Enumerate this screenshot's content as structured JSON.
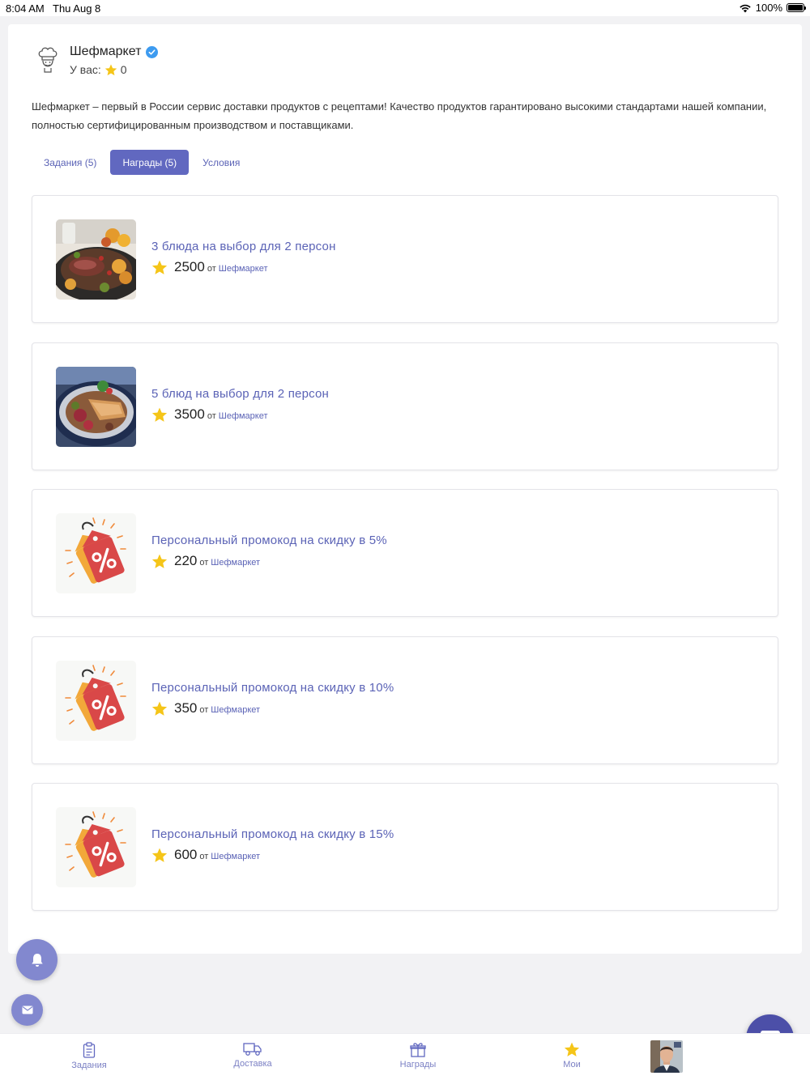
{
  "status": {
    "time": "8:04 AM",
    "date": "Thu Aug 8",
    "battery": "100%"
  },
  "brand": {
    "name": "Шефмаркет",
    "balance_label": "У вас:",
    "balance_value": "0"
  },
  "description": "Шефмаркет – первый в России сервис доставки продуктов с рецептами! Качество продуктов гарантировано высокими стандартами нашей компании, полностью сертифицированным производством и поставщиками.",
  "tabs": [
    {
      "label": "Задания (5)",
      "active": false
    },
    {
      "label": "Награды (5)",
      "active": true
    },
    {
      "label": "Условия",
      "active": false
    }
  ],
  "rewards": [
    {
      "title": "3 блюда на выбор для 2 персон",
      "price": "2500",
      "from": "от",
      "merchant": "Шефмаркет",
      "image": "food-steak"
    },
    {
      "title": "5 блюд на выбор для 2 персон",
      "price": "3500",
      "from": "от",
      "merchant": "Шефмаркет",
      "image": "food-chicken"
    },
    {
      "title": "Персональный промокод на скидку в 5%",
      "price": "220",
      "from": "от",
      "merchant": "Шефмаркет",
      "image": "discount-tag"
    },
    {
      "title": "Персональный промокод на скидку в 10%",
      "price": "350",
      "from": "от",
      "merchant": "Шефмаркет",
      "image": "discount-tag"
    },
    {
      "title": "Персональный промокод на скидку в 15%",
      "price": "600",
      "from": "от",
      "merchant": "Шефмаркет",
      "image": "discount-tag"
    }
  ],
  "nav": [
    {
      "label": "Задания",
      "icon": "clipboard-icon"
    },
    {
      "label": "Доставка",
      "icon": "truck-icon"
    },
    {
      "label": "Награды",
      "icon": "gift-icon"
    },
    {
      "label": "Мои",
      "icon": "star-icon"
    },
    {
      "label": "",
      "icon": "avatar"
    }
  ],
  "colors": {
    "accent": "#6168c0",
    "link": "#5b63b6",
    "star": "#f5c518",
    "fab": "#8288cf",
    "chat": "#4c4fa8"
  }
}
